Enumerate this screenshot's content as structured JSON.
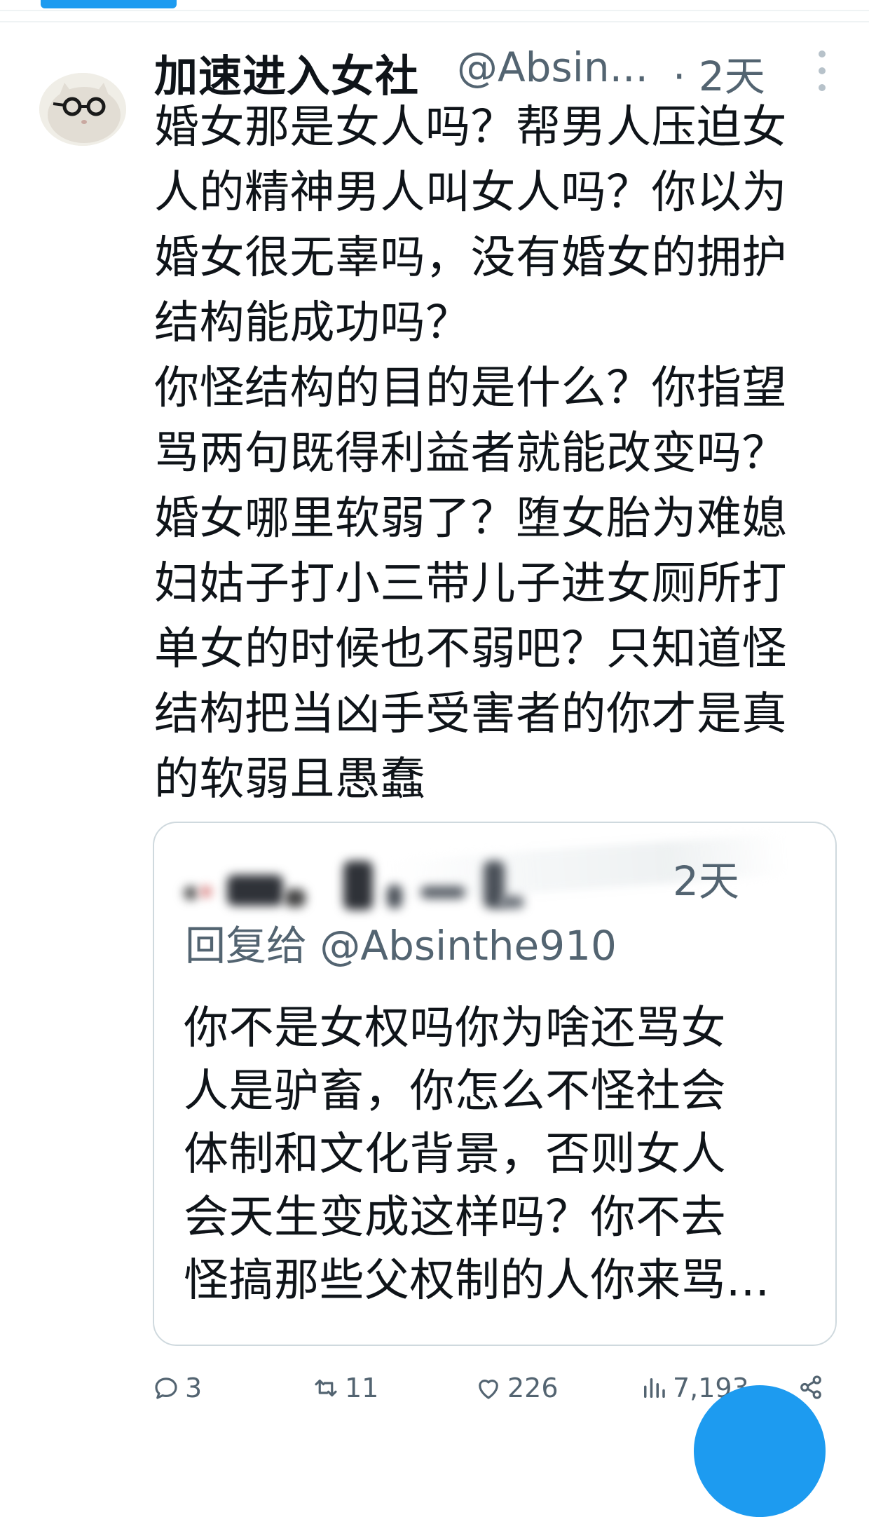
{
  "tweet": {
    "author_name": "加速进入女社",
    "handle": "@Absin...",
    "time": "· 2天",
    "text": "婚女那是女人吗？帮男人压迫女\n人的精神男人叫女人吗？你以为\n婚女很无辜吗，没有婚女的拥护\n结构能成功吗？\n你怪结构的目的是什么？你指望\n骂两句既得利益者就能改变吗？\n婚女哪里软弱了？堕女胎为难媳\n妇姑子打小三带儿子进女厕所打\n单女的时候也不弱吧？只知道怪\n结构把当凶手受害者的你才是真\n的软弱且愚蠢"
  },
  "quote": {
    "time": "2天",
    "reply_to": "回复给 @Absinthe910",
    "text": "你不是女权吗你为啥还骂女\n人是驴畜，你怎么不怪社会\n体制和文化背景，否则女人\n会天生变成这样吗？你不去\n怪搞那些父权制的人你来骂..."
  },
  "actions": {
    "replies": "3",
    "retweets": "11",
    "likes": "226",
    "views": "7,193"
  },
  "colors": {
    "accent": "#1d9bf0",
    "secondary_text": "#536471",
    "border": "#cfd9de"
  }
}
